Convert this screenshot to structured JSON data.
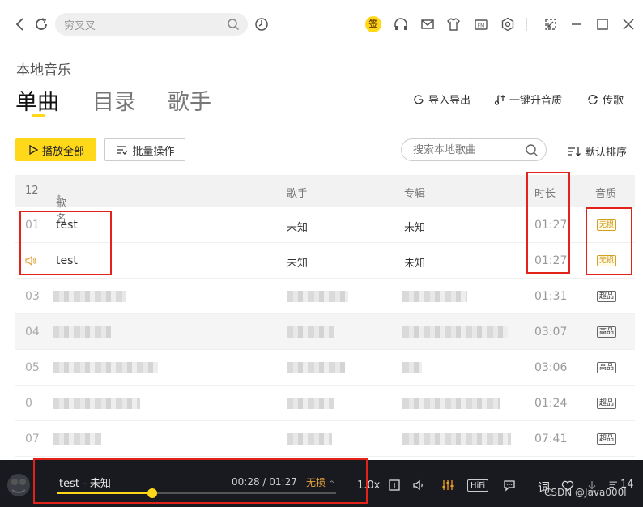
{
  "topbar": {
    "search_value": "穷叉叉",
    "sign_label": "签",
    "icons": [
      "back-icon",
      "refresh-icon",
      "search-icon",
      "history-icon",
      "sign-in-icon",
      "headphone-icon",
      "mail-icon",
      "skin-icon",
      "fm-icon",
      "settings-icon",
      "mini-mode-icon",
      "minimize-icon",
      "maximize-icon",
      "close-icon"
    ]
  },
  "page": {
    "subtitle": "本地音乐",
    "tabs": [
      "单曲",
      "目录",
      "歌手"
    ],
    "actions": [
      "导入导出",
      "一键升音质",
      "传歌"
    ]
  },
  "toolbar": {
    "play_all": "播放全部",
    "batch": "批量操作",
    "search_placeholder": "搜索本地歌曲",
    "sort": "默认排序"
  },
  "table": {
    "count": "12",
    "headers": [
      "歌名",
      "歌手",
      "专辑",
      "时长",
      "音质"
    ],
    "rows": [
      {
        "idx": "01",
        "name": "test",
        "artist": "未知",
        "album": "未知",
        "duration": "01:27",
        "quality": "无损"
      },
      {
        "idx": "",
        "name": "test",
        "artist": "未知",
        "album": "未知",
        "duration": "01:27",
        "quality": "无损",
        "playing": true
      },
      {
        "idx": "03",
        "duration": "01:31",
        "quality": "超品"
      },
      {
        "idx": "04",
        "duration": "03:07",
        "quality": "高品"
      },
      {
        "idx": "05",
        "duration": "03:06",
        "quality": "高品"
      },
      {
        "idx": "0",
        "duration": "01:24",
        "quality": "超品"
      },
      {
        "idx": "07",
        "duration": "07:41",
        "quality": "超品"
      }
    ]
  },
  "player": {
    "title": "test - 未知",
    "time": "00:28 / 01:27",
    "quality": "无损",
    "progress": 0.34,
    "speed": "1.0x",
    "hifi": "HiFi",
    "lyric": "词",
    "count": "14"
  },
  "watermark": "CSDN @Java000l",
  "colors": {
    "accent": "#ffd81a",
    "annotation": "#e2231a",
    "player_bg": "#181a1f"
  }
}
